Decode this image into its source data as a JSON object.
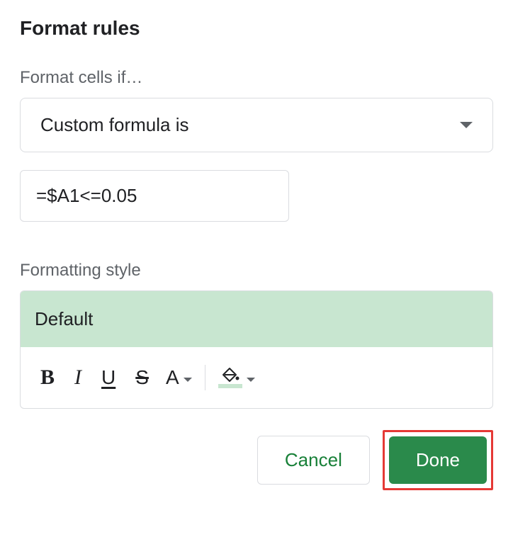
{
  "section": {
    "title": "Format rules",
    "condition_label": "Format cells if…"
  },
  "condition": {
    "selected": "Custom formula is",
    "formula": "=$A1<=0.05"
  },
  "style": {
    "label": "Formatting style",
    "preview": "Default"
  },
  "buttons": {
    "cancel": "Cancel",
    "done": "Done"
  },
  "icons": {
    "bold": "B",
    "italic": "I",
    "underline": "U",
    "strike": "S",
    "textcolor": "A"
  }
}
